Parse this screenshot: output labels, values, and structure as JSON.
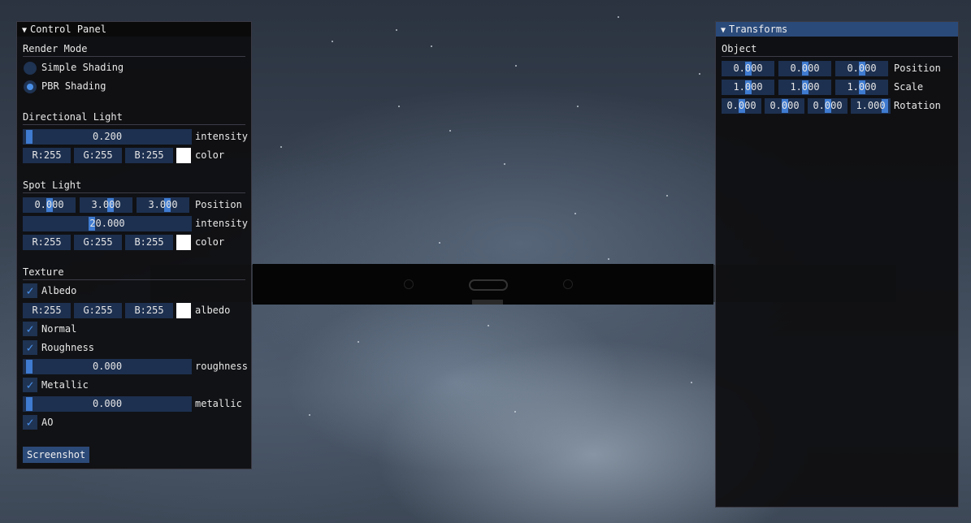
{
  "control_panel": {
    "title": "Control Panel",
    "render_mode": {
      "heading": "Render Mode",
      "options": [
        {
          "label": "Simple Shading",
          "selected": false
        },
        {
          "label": "PBR Shading",
          "selected": true
        }
      ]
    },
    "directional_light": {
      "heading": "Directional Light",
      "intensity_value": "0.200",
      "intensity_fraction": 0.02,
      "intensity_label": "intensity",
      "r": "R:255",
      "g": "G:255",
      "b": "B:255",
      "color_label": "color",
      "swatch_color": "#ffffff"
    },
    "spot_light": {
      "heading": "Spot Light",
      "position": [
        "0.000",
        "3.000",
        "3.000"
      ],
      "position_label": "Position",
      "intensity_value": "20.000",
      "intensity_label": "intensity",
      "r": "R:255",
      "g": "G:255",
      "b": "B:255",
      "color_label": "color",
      "swatch_color": "#ffffff"
    },
    "texture": {
      "heading": "Texture",
      "albedo_label": "Albedo",
      "albedo_checked": true,
      "albedo_r": "R:255",
      "albedo_g": "G:255",
      "albedo_b": "B:255",
      "albedo_color_label": "albedo",
      "normal_label": "Normal",
      "normal_checked": true,
      "roughness_label": "Roughness",
      "roughness_checked": true,
      "roughness_value": "0.000",
      "roughness_slider_label": "roughness",
      "metallic_label": "Metallic",
      "metallic_checked": true,
      "metallic_value": "0.000",
      "metallic_slider_label": "metallic",
      "ao_label": "AO",
      "ao_checked": true
    },
    "screenshot_label": "Screenshot"
  },
  "transforms": {
    "title": "Transforms",
    "heading": "Object",
    "position": [
      "0.000",
      "0.000",
      "0.000"
    ],
    "position_label": "Position",
    "scale": [
      "1.000",
      "1.000",
      "1.000"
    ],
    "scale_label": "Scale",
    "rotation": [
      "0.000",
      "0.000",
      "0.000",
      "1.000"
    ],
    "rotation_label": "Rotation"
  },
  "colors": {
    "accent": "#3f7bd0",
    "frame_bg": "#1d3050",
    "title_active": "#2a4a7a"
  },
  "icons": {
    "collapse": "triangle-down-icon",
    "check": "checkmark-icon"
  }
}
